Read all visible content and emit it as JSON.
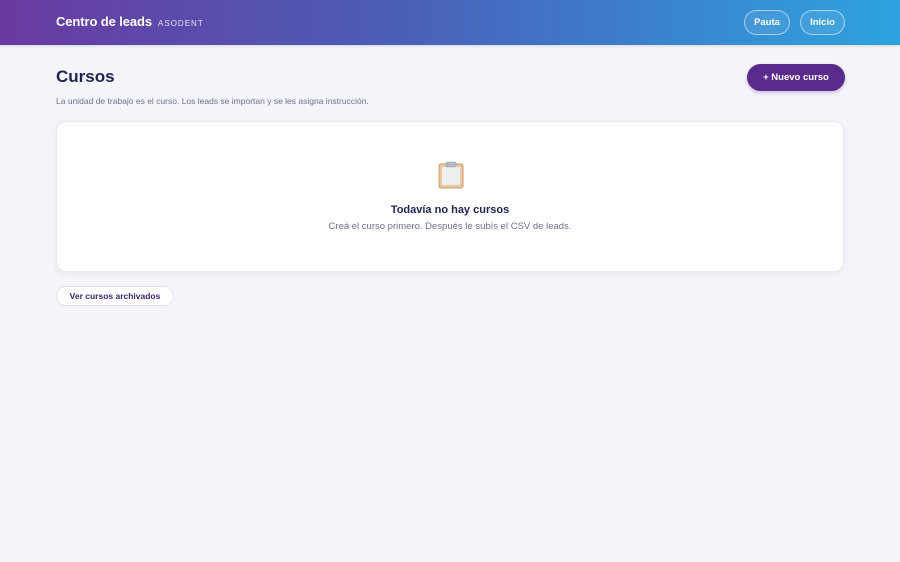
{
  "header": {
    "app_title": "Centro de leads",
    "org_name": "ASODENT",
    "nav": {
      "pauta_label": "Pauta",
      "inicio_label": "Inicio"
    }
  },
  "page": {
    "title": "Cursos",
    "description": "La unidad de trabajo es el curso. Los leads se importan y se les asigna instrucción.",
    "new_course_label": "+ Nuevo curso"
  },
  "empty_state": {
    "icon": "clipboard-icon",
    "title": "Todavía no hay cursos",
    "message": "Creá el curso primero. Después le subís el CSV de leads."
  },
  "archived": {
    "label": "Ver cursos archivados"
  },
  "colors": {
    "header_gradient_start": "#6a3aa0",
    "header_gradient_end": "#2ea3e0",
    "primary_button": "#5a2a8c",
    "page_background": "#f4f5fa",
    "title_text": "#1e2350"
  }
}
